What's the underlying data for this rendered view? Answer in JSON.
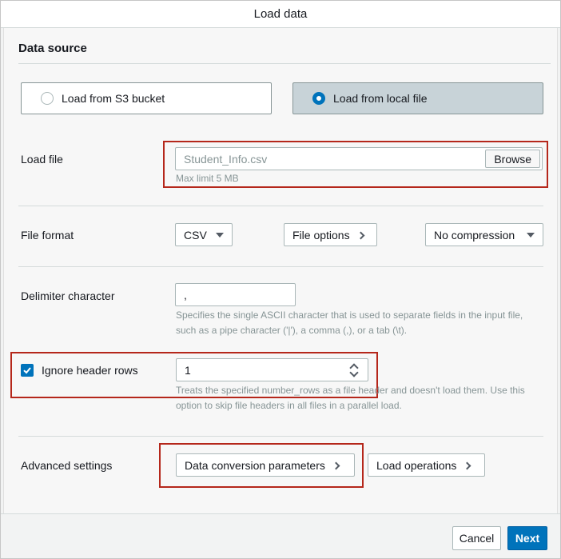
{
  "dialog": {
    "title": "Load data"
  },
  "data_source": {
    "heading": "Data source",
    "options": [
      {
        "label": "Load from S3 bucket",
        "selected": false
      },
      {
        "label": "Load from local file",
        "selected": true
      }
    ]
  },
  "load_file": {
    "label": "Load file",
    "value": "Student_Info.csv",
    "browse_label": "Browse",
    "hint": "Max limit 5 MB"
  },
  "file_format": {
    "label": "File format",
    "format_value": "CSV",
    "file_options_label": "File options",
    "compression_value": "No compression"
  },
  "delimiter": {
    "label": "Delimiter character",
    "value": ",",
    "hint": "Specifies the single ASCII character that is used to separate fields in the input file, such as a pipe character ('|'), a comma (,), or a tab (\\t)."
  },
  "ignore_header": {
    "label": "Ignore header rows",
    "checked": true,
    "value": "1",
    "hint": "Treats the specified number_rows as a file header and doesn't load them. Use this option to skip file headers in all files in a parallel load."
  },
  "advanced": {
    "label": "Advanced settings",
    "data_conversion_label": "Data conversion parameters",
    "load_operations_label": "Load operations"
  },
  "footer": {
    "cancel_label": "Cancel",
    "next_label": "Next"
  },
  "colors": {
    "accent": "#0073bb",
    "highlight": "#b5271b",
    "selected_card": "#c8d3d8"
  }
}
